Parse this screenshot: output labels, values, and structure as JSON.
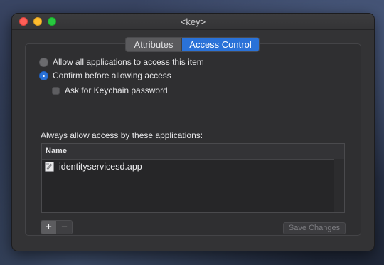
{
  "window": {
    "title": "<key>"
  },
  "tabs": [
    {
      "label": "Attributes",
      "selected": false
    },
    {
      "label": "Access Control",
      "selected": true
    }
  ],
  "access_options": {
    "allow_all_label": "Allow all applications to access this item",
    "allow_all_selected": false,
    "confirm_label": "Confirm before allowing access",
    "confirm_selected": true,
    "ask_password_label": "Ask for Keychain password",
    "ask_password_checked": false
  },
  "apps_section": {
    "label": "Always allow access by these applications:",
    "column_header": "Name",
    "rows": [
      {
        "name": "identityservicesd.app",
        "icon": "app-icon"
      }
    ]
  },
  "buttons": {
    "add_label": "+",
    "remove_label": "−",
    "save_label": "Save Changes"
  },
  "colors": {
    "accent": "#2a72d8",
    "window_bg": "#333335"
  }
}
